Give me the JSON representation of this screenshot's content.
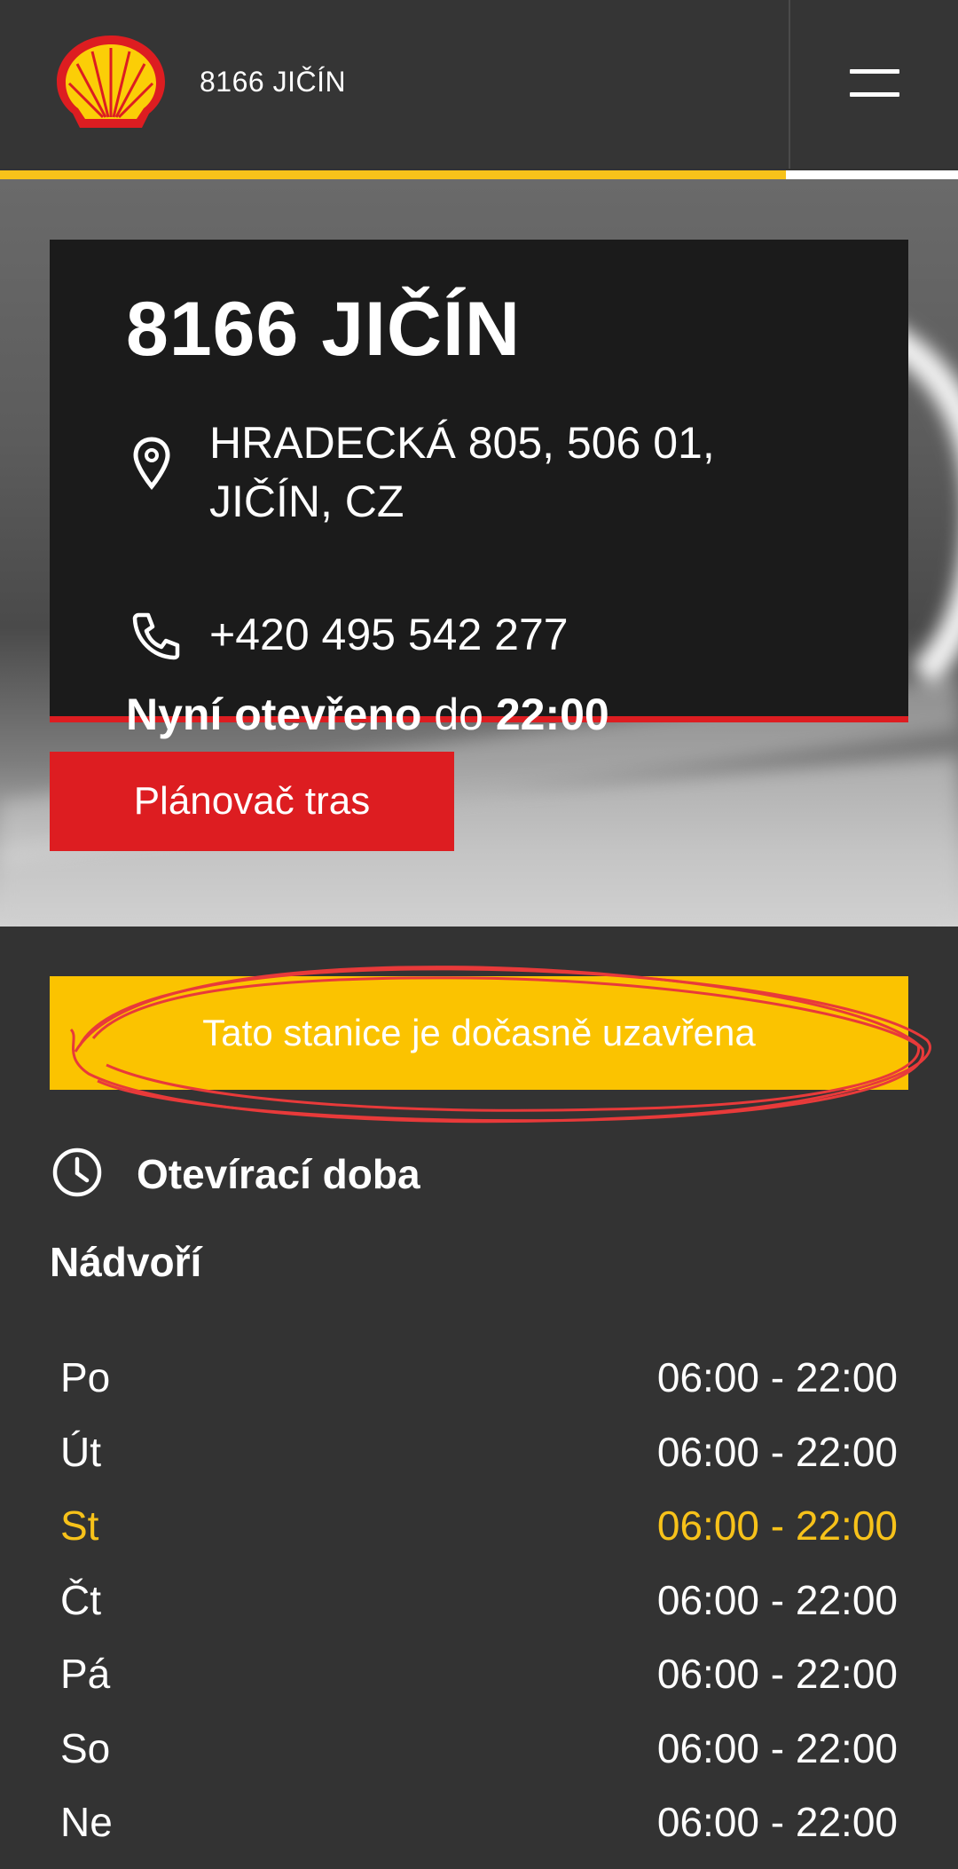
{
  "header": {
    "title": "8166 JIČÍN",
    "logo_icon": "shell-logo-icon",
    "menu_icon": "hamburger-menu-icon",
    "progress_fraction": 0.82
  },
  "station": {
    "name": "8166 JIČÍN",
    "address_line1": "HRADECKÁ 805, 506 01,",
    "address_line2": "JIČÍN, CZ",
    "phone": "+420 495 542 277",
    "status_prefix": "Nyní otevřeno",
    "status_mid": "do",
    "status_time": "22:00"
  },
  "route_button": {
    "label": "Plánovač tras"
  },
  "notice": {
    "text": "Tato stanice je dočasně uzavřena"
  },
  "hours": {
    "title": "Otevírací doba",
    "section": "Nádvoří",
    "rows": [
      {
        "day": "Po",
        "time": "06:00 - 22:00"
      },
      {
        "day": "Út",
        "time": "06:00 - 22:00"
      },
      {
        "day": "St",
        "time": "06:00 - 22:00"
      },
      {
        "day": "Čt",
        "time": "06:00 - 22:00"
      },
      {
        "day": "Pá",
        "time": "06:00 - 22:00"
      },
      {
        "day": "So",
        "time": "06:00 - 22:00"
      },
      {
        "day": "Ne",
        "time": "06:00 - 22:00"
      }
    ],
    "today": "St"
  },
  "colors": {
    "shell_yellow": "#fbc300",
    "shell_red": "#dd1d21",
    "today_highlight": "#f7c21a",
    "background": "#333333"
  }
}
